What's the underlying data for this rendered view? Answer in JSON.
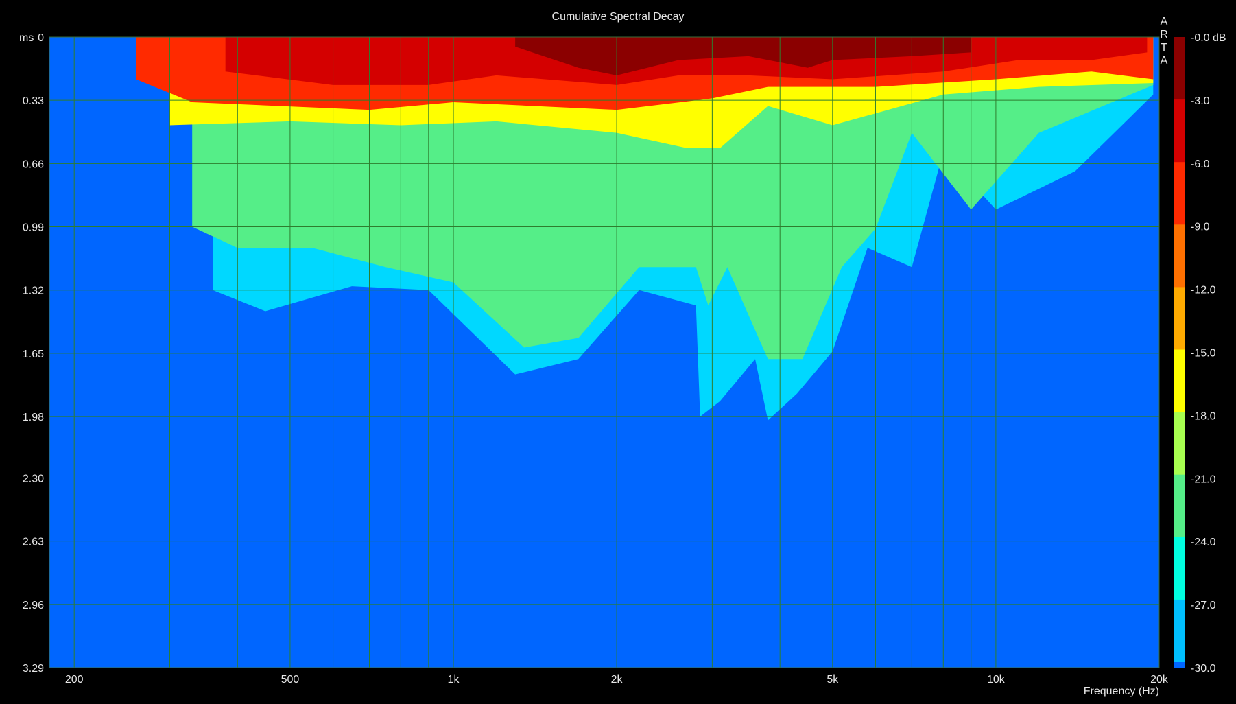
{
  "chart_data": {
    "type": "heatmap",
    "title": "Cumulative Spectral Decay",
    "xlabel": "Frequency (Hz)",
    "ylabel": "ms",
    "x_scale": "log",
    "xlim": [
      180,
      20000
    ],
    "ylim": [
      0,
      3.29
    ],
    "x_ticks": [
      {
        "value": 200,
        "label": "200"
      },
      {
        "value": 500,
        "label": "500"
      },
      {
        "value": 1000,
        "label": "1k"
      },
      {
        "value": 2000,
        "label": "2k"
      },
      {
        "value": 5000,
        "label": "5k"
      },
      {
        "value": 10000,
        "label": "10k"
      },
      {
        "value": 20000,
        "label": "20k"
      }
    ],
    "y_ticks": [
      "0",
      "0.33",
      "0.66",
      "0.99",
      "1.32",
      "1.65",
      "1.98",
      "2.30",
      "2.63",
      "2.96",
      "3.29"
    ],
    "colorbar": {
      "labels": [
        "-0.0 dB",
        "-3.0",
        "-6.0",
        "-9.0",
        "-12.0",
        "-15.0",
        "-18.0",
        "-21.0",
        "-24.0",
        "-27.0",
        "-30.0"
      ],
      "levels": [
        {
          "range": [
            -3,
            0
          ],
          "color": "#8b0000"
        },
        {
          "range": [
            -6,
            -3
          ],
          "color": "#d40000"
        },
        {
          "range": [
            -9,
            -6
          ],
          "color": "#ff2a00"
        },
        {
          "range": [
            -12,
            -9
          ],
          "color": "#ff7000"
        },
        {
          "range": [
            -15,
            -12
          ],
          "color": "#ffaa00"
        },
        {
          "range": [
            -18,
            -15
          ],
          "color": "#ffff00"
        },
        {
          "range": [
            -21,
            -18
          ],
          "color": "#a8ff50"
        },
        {
          "range": [
            -24,
            -21
          ],
          "color": "#55ee88"
        },
        {
          "range": [
            -27,
            -24
          ],
          "color": "#00ffe0"
        },
        {
          "range": [
            -30,
            -27
          ],
          "color": "#00c0ff"
        }
      ],
      "floor_color": "#0066ff"
    },
    "isolines_ms": [
      {
        "level": "-3 dB",
        "points": [
          [
            1300,
            0.05
          ],
          [
            1700,
            0.16
          ],
          [
            2000,
            0.2
          ],
          [
            2600,
            0.12
          ],
          [
            3500,
            0.1
          ],
          [
            4500,
            0.16
          ],
          [
            5000,
            0.12
          ],
          [
            7000,
            0.1
          ],
          [
            9000,
            0.08
          ]
        ]
      },
      {
        "level": "-6 dB",
        "points": [
          [
            380,
            0.18
          ],
          [
            600,
            0.25
          ],
          [
            900,
            0.25
          ],
          [
            1200,
            0.2
          ],
          [
            2000,
            0.25
          ],
          [
            2600,
            0.2
          ],
          [
            3500,
            0.2
          ],
          [
            5000,
            0.22
          ],
          [
            8000,
            0.18
          ],
          [
            11000,
            0.12
          ],
          [
            15000,
            0.12
          ],
          [
            19000,
            0.08
          ]
        ]
      },
      {
        "level": "-12 dB",
        "points": [
          [
            260,
            0.22
          ],
          [
            330,
            0.34
          ],
          [
            700,
            0.38
          ],
          [
            1000,
            0.34
          ],
          [
            2000,
            0.38
          ],
          [
            3000,
            0.32
          ],
          [
            3800,
            0.26
          ],
          [
            6000,
            0.26
          ],
          [
            10000,
            0.22
          ],
          [
            15000,
            0.18
          ],
          [
            19500,
            0.22
          ]
        ]
      },
      {
        "level": "-18 dB",
        "points": [
          [
            300,
            0.46
          ],
          [
            500,
            0.44
          ],
          [
            800,
            0.46
          ],
          [
            1200,
            0.44
          ],
          [
            2000,
            0.5
          ],
          [
            2700,
            0.58
          ],
          [
            3100,
            0.58
          ],
          [
            3800,
            0.36
          ],
          [
            5000,
            0.46
          ],
          [
            8000,
            0.3
          ],
          [
            12000,
            0.26
          ],
          [
            19500,
            0.24
          ]
        ]
      },
      {
        "level": "-24 dB",
        "points": [
          [
            330,
            0.99
          ],
          [
            400,
            1.1
          ],
          [
            550,
            1.1
          ],
          [
            750,
            1.2
          ],
          [
            1000,
            1.28
          ],
          [
            1350,
            1.62
          ],
          [
            1700,
            1.57
          ],
          [
            2200,
            1.2
          ],
          [
            2800,
            1.2
          ],
          [
            2950,
            1.4
          ],
          [
            3200,
            1.2
          ],
          [
            3800,
            1.68
          ],
          [
            4400,
            1.68
          ],
          [
            5200,
            1.2
          ],
          [
            6000,
            1.0
          ],
          [
            7000,
            0.5
          ],
          [
            9000,
            0.9
          ],
          [
            12000,
            0.5
          ],
          [
            19500,
            0.25
          ]
        ]
      },
      {
        "level": "-27 dB",
        "points": [
          [
            360,
            1.32
          ],
          [
            450,
            1.43
          ],
          [
            650,
            1.3
          ],
          [
            900,
            1.32
          ],
          [
            1300,
            1.76
          ],
          [
            1700,
            1.68
          ],
          [
            2200,
            1.32
          ],
          [
            2800,
            1.4
          ],
          [
            2850,
            1.98
          ],
          [
            3100,
            1.9
          ],
          [
            3600,
            1.68
          ],
          [
            3800,
            2.0
          ],
          [
            4300,
            1.86
          ],
          [
            5000,
            1.64
          ],
          [
            5800,
            1.1
          ],
          [
            7000,
            1.2
          ],
          [
            8000,
            0.6
          ],
          [
            10000,
            0.9
          ],
          [
            14000,
            0.7
          ],
          [
            19500,
            0.3
          ]
        ]
      }
    ]
  }
}
